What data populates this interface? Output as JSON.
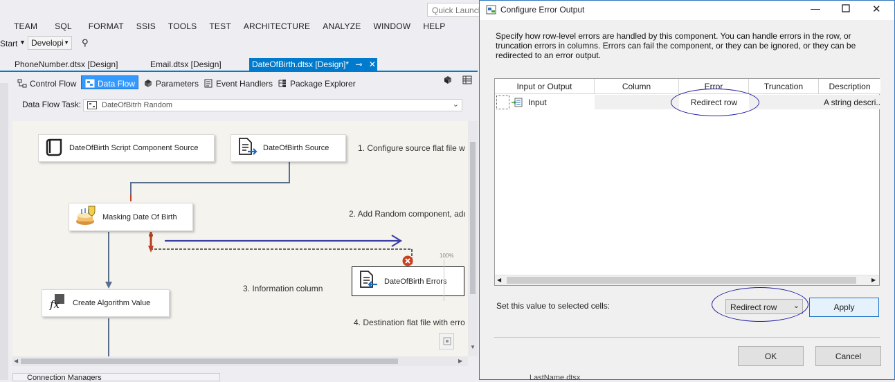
{
  "quick_launch": "Quick Launch",
  "menu": [
    "TEAM",
    "SQL",
    "FORMAT",
    "SSIS",
    "TOOLS",
    "TEST",
    "ARCHITECTURE",
    "ANALYZE",
    "WINDOW",
    "HELP"
  ],
  "toolbar": {
    "start_label": "Start",
    "config_value": "Developi"
  },
  "doc_tabs": [
    "PhoneNumber.dtsx [Design]",
    "Email.dtsx [Design]",
    "DateOfBirth.dtsx [Design]*"
  ],
  "designer_tabs": [
    "Control Flow",
    "Data Flow",
    "Parameters",
    "Event Handlers",
    "Package Explorer"
  ],
  "task": {
    "label": "Data Flow Task:",
    "value": "DateOfBitrh Random"
  },
  "nodes": {
    "script_source": "DateOfBirth Script Component Source",
    "source": "DateOfBirth Source",
    "masking": "Masking Date Of Birth",
    "errors": "DateOfBirth Errors",
    "algorithm": "Create Algorithm Value"
  },
  "annotations": {
    "a1": "1. Configure source flat file w",
    "a2": "2. Add Random component, adı",
    "a3": "3. Information column",
    "a4": "4. Destination flat file with erro"
  },
  "zoom": "100%",
  "connection_managers": "Connection Managers",
  "dialog": {
    "title": "Configure Error Output",
    "description": "Specify how row-level errors are handled by this component. You can handle errors in the row, or truncation errors in columns. Errors can fail the component, or they can be ignored, or they can be redirected to an error output.",
    "columns": [
      "Input or Output",
      "Column",
      "Error",
      "Truncation",
      "Description"
    ],
    "row": {
      "input": "Input",
      "column": "",
      "error": "Redirect row",
      "truncation": "",
      "description": "A string descri..."
    },
    "set_label": "Set this value to selected cells:",
    "set_value": "Redirect row",
    "apply": "Apply",
    "ok": "OK",
    "cancel": "Cancel"
  },
  "bottom_tab": "LastName.dtsx"
}
